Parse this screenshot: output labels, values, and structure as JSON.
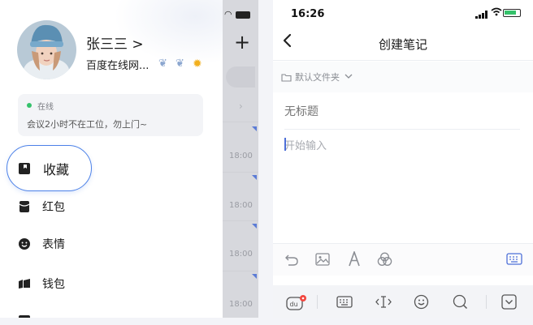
{
  "left_screen": {
    "background_chat": {
      "plus_label": "+",
      "times": [
        "18:00",
        "18:00",
        "18:00",
        "18:00",
        "18:00"
      ]
    },
    "drawer": {
      "profile": {
        "name": "张三三 >",
        "subtitle": "百度在线网..."
      },
      "status": {
        "online_label": "在线",
        "message": "会议2小时不在工位，勿上门~"
      },
      "menu": {
        "favorites": "收藏",
        "red_packet": "红包",
        "stickers": "表情",
        "wallet": "钱包"
      }
    }
  },
  "right_screen": {
    "status_bar": {
      "time": "16:26"
    },
    "nav": {
      "title": "创建笔记",
      "back_icon": "chevron-left-icon"
    },
    "folder": {
      "label": "默认文件夹"
    },
    "editor": {
      "title_placeholder": "无标题",
      "body_placeholder": "开始输入"
    },
    "toolbar_icons": [
      "undo-icon",
      "image-icon",
      "text-format-icon",
      "color-palette-icon",
      "keyboard-icon"
    ],
    "keyboard_bar_icons": [
      "du-mascot-icon",
      "keyboard-icon",
      "cursor-move-icon",
      "emoji-icon",
      "search-icon",
      "collapse-keyboard-icon"
    ]
  },
  "colors": {
    "accent_blue": "#4d82e8",
    "online_green": "#35c26b",
    "notification_red": "#f2473f",
    "sun_yellow": "#f2b01e"
  }
}
